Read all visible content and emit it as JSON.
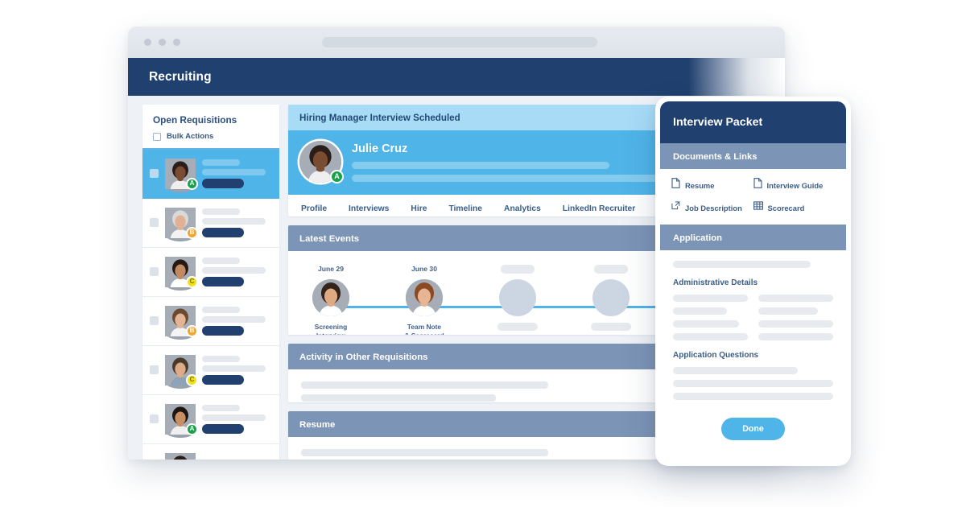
{
  "app": {
    "title": "Recruiting"
  },
  "sidebar": {
    "title": "Open Requisitions",
    "bulk_actions_label": "Bulk Actions",
    "candidates": [
      {
        "grade": "A",
        "grade_color": "#16a34a",
        "selected": true
      },
      {
        "grade": "B",
        "grade_color": "#f5a623",
        "selected": false
      },
      {
        "grade": "C",
        "grade_color": "#f0e118",
        "selected": false
      },
      {
        "grade": "B",
        "grade_color": "#f5a623",
        "selected": false
      },
      {
        "grade": "C",
        "grade_color": "#f0e118",
        "selected": false
      },
      {
        "grade": "A",
        "grade_color": "#16a34a",
        "selected": false
      }
    ]
  },
  "main": {
    "status_banner": "Hiring Manager Interview Scheduled",
    "candidate": {
      "name": "Julie Cruz",
      "grade": "A"
    },
    "tabs": [
      {
        "label": "Profile"
      },
      {
        "label": "Interviews"
      },
      {
        "label": "Hire"
      },
      {
        "label": "Timeline"
      },
      {
        "label": "Analytics"
      },
      {
        "label": "LinkedIn Recruiter"
      }
    ],
    "sections": {
      "latest_events": "Latest Events",
      "activity_other": "Activity in Other Requisitions",
      "resume": "Resume"
    },
    "timeline": [
      {
        "date": "June 29",
        "caption": "Screening\nInterview Complete",
        "has_photo": true
      },
      {
        "date": "June 30",
        "caption": "Team Note\n& Scorecard",
        "has_photo": true
      },
      {
        "date": "",
        "caption": "",
        "has_photo": false
      },
      {
        "date": "",
        "caption": "",
        "has_photo": false
      },
      {
        "date": "",
        "caption": "",
        "has_photo": false
      }
    ]
  },
  "panel": {
    "title": "Interview Packet",
    "documents_header": "Documents & Links",
    "documents": [
      {
        "label": "Resume",
        "icon": "document-icon"
      },
      {
        "label": "Interview Guide",
        "icon": "document-icon"
      },
      {
        "label": "Job Description",
        "icon": "external-link-icon"
      },
      {
        "label": "Scorecard",
        "icon": "scorecard-grid-icon"
      }
    ],
    "application_header": "Application",
    "administrative_details": "Administrative Details",
    "application_questions": "Application Questions",
    "done_label": "Done"
  },
  "colors": {
    "navy": "#20406f",
    "accent_blue": "#4fb4e8",
    "light_blue": "#a7dbf6",
    "slate": "#7c94b5"
  }
}
